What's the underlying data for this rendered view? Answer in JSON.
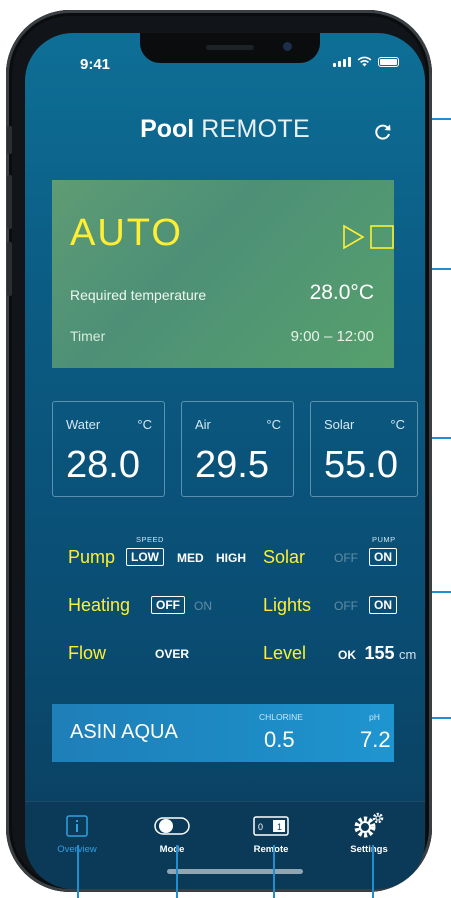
{
  "status": {
    "time": "9:41"
  },
  "header": {
    "title_bold": "Pool",
    "title_light": "REMOTE"
  },
  "mode": {
    "name": "AUTO",
    "required_temp_label": "Required temperature",
    "required_temp_value": "28.0°C",
    "timer_label": "Timer",
    "timer_value": "9:00 – 12:00"
  },
  "temps": [
    {
      "label": "Water",
      "unit": "°C",
      "value": "28.0"
    },
    {
      "label": "Air",
      "unit": "°C",
      "value": "29.5"
    },
    {
      "label": "Solar",
      "unit": "°C",
      "value": "55.0"
    }
  ],
  "controls": {
    "pump": {
      "label": "Pump",
      "caption": "SPEED",
      "options": [
        "LOW",
        "MED",
        "HIGH"
      ],
      "selected": "LOW"
    },
    "solar": {
      "label": "Solar",
      "caption": "PUMP",
      "off": "OFF",
      "on": "ON",
      "selected": "ON"
    },
    "heating": {
      "label": "Heating",
      "off": "OFF",
      "on": "ON",
      "selected": "OFF"
    },
    "lights": {
      "label": "Lights",
      "off": "OFF",
      "on": "ON",
      "selected": "ON"
    },
    "flow": {
      "label": "Flow",
      "value": "OVER"
    },
    "level": {
      "label": "Level",
      "status": "OK",
      "value": "155",
      "unit": "cm"
    }
  },
  "water_quality": {
    "name": "ASIN AQUA",
    "chlorine_label": "CHLORINE",
    "chlorine_value": "0.5",
    "ph_label": "pH",
    "ph_value": "7.2"
  },
  "tabs": [
    {
      "label": "Overview",
      "icon": "info-icon",
      "active": true
    },
    {
      "label": "Mode",
      "icon": "toggle-icon",
      "active": false
    },
    {
      "label": "Remote",
      "icon": "switch-icon",
      "active": false
    },
    {
      "label": "Settings",
      "icon": "gear-icon",
      "active": false
    }
  ],
  "colors": {
    "accent_yellow": "#ffee33",
    "active_tab": "#2f9fe0",
    "mode_card": "#4d9077",
    "aqua_card": "#1d8ac4",
    "callout": "#1f8fcf"
  }
}
